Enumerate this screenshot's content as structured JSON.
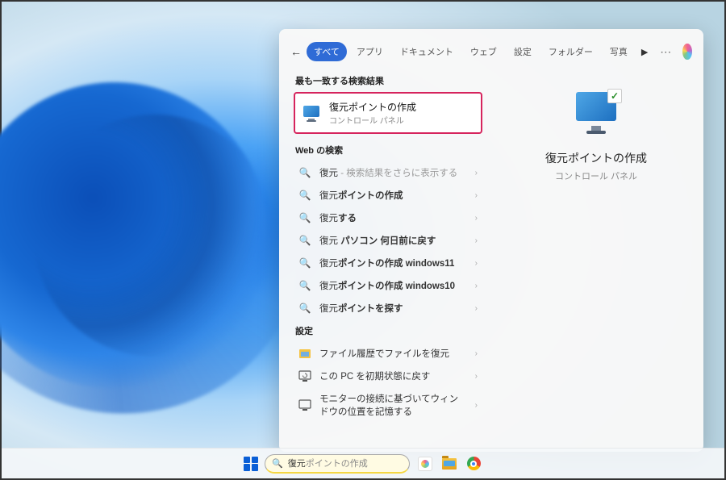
{
  "searchQuery": {
    "typed": "復元",
    "suggestion": "ポイントの作成"
  },
  "tabs": {
    "all": "すべて",
    "apps": "アプリ",
    "documents": "ドキュメント",
    "web": "ウェブ",
    "settings": "設定",
    "folders": "フォルダー",
    "photos": "写真"
  },
  "sections": {
    "bestMatch": "最も一致する検索結果",
    "webSearch": "Web の検索",
    "settings": "設定"
  },
  "bestMatch": {
    "title": "復元ポイントの作成",
    "subtitle": "コントロール パネル"
  },
  "webResults": [
    {
      "pre": "復元",
      "muted": " - 検索結果をさらに表示する",
      "bold": ""
    },
    {
      "pre": "復元",
      "bold": "ポイントの作成",
      "muted": ""
    },
    {
      "pre": "復元",
      "bold": "する",
      "muted": ""
    },
    {
      "pre": "復元 ",
      "bold": "パソコン 何日前に戻す",
      "muted": ""
    },
    {
      "pre": "復元",
      "bold": "ポイントの作成 windows11",
      "muted": ""
    },
    {
      "pre": "復元",
      "bold": "ポイントの作成 windows10",
      "muted": ""
    },
    {
      "pre": "復元",
      "bold": "ポイントを探す",
      "muted": ""
    }
  ],
  "settingsResults": [
    {
      "icon": "file-history",
      "label": "ファイル履歴でファイルを復元"
    },
    {
      "icon": "reset-pc",
      "label": "この PC を初期状態に戻す"
    },
    {
      "icon": "monitor-pos",
      "label": "モニターの接続に基づいてウィンドウの位置を記憶する"
    }
  ],
  "preview": {
    "title": "復元ポイントの作成",
    "subtitle": "コントロール パネル"
  }
}
